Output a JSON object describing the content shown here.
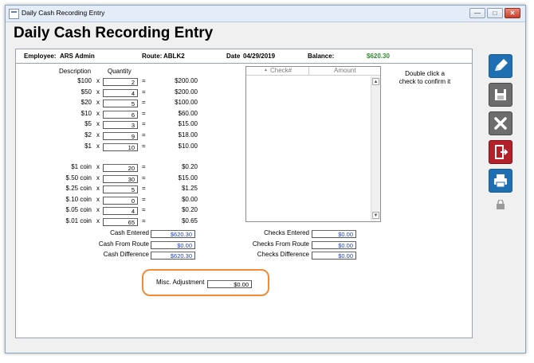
{
  "window": {
    "title": "Daily Cash Recording Entry",
    "minimize": "—",
    "maximize": "□",
    "close": "✕"
  },
  "heading": "Daily Cash Recording Entry",
  "info": {
    "employee_label": "Employee:",
    "employee": "ARS Admin",
    "route_label": "Route:",
    "route": "ABLK2",
    "date_label": "Date",
    "date": "04/29/2019",
    "balance_label": "Balance:",
    "balance": "$620.30"
  },
  "cash": {
    "col_description": "Description",
    "col_quantity": "Quantity",
    "x": "x",
    "eq": "=",
    "bills": [
      {
        "desc": "$100",
        "qty": "2",
        "amount": "$200.00"
      },
      {
        "desc": "$50",
        "qty": "4",
        "amount": "$200.00"
      },
      {
        "desc": "$20",
        "qty": "5",
        "amount": "$100.00"
      },
      {
        "desc": "$10",
        "qty": "6",
        "amount": "$60.00"
      },
      {
        "desc": "$5",
        "qty": "3",
        "amount": "$15.00"
      },
      {
        "desc": "$2",
        "qty": "9",
        "amount": "$18.00"
      },
      {
        "desc": "$1",
        "qty": "10",
        "amount": "$10.00"
      }
    ],
    "coins": [
      {
        "desc": "$1 coin",
        "qty": "20",
        "amount": "$0.20"
      },
      {
        "desc": "$.50 coin",
        "qty": "30",
        "amount": "$15.00"
      },
      {
        "desc": "$.25 coin",
        "qty": "5",
        "amount": "$1.25"
      },
      {
        "desc": "$.10 coin",
        "qty": "0",
        "amount": "$0.00"
      },
      {
        "desc": "$.05 coin",
        "qty": "4",
        "amount": "$0.20"
      },
      {
        "desc": "$.01 coin",
        "qty": "65",
        "amount": "$0.65"
      }
    ],
    "totals": [
      {
        "label": "Cash Entered",
        "value": "$620.30"
      },
      {
        "label": "Cash From Route",
        "value": "$0.00"
      },
      {
        "label": "Cash Difference",
        "value": "$620.30"
      }
    ]
  },
  "checks": {
    "col_check": "Check#",
    "col_amount": "Amount",
    "sort_arrow": "▲",
    "hint": [
      "Double click a",
      "check to confirm it"
    ],
    "totals": [
      {
        "label": "Checks Entered",
        "value": "$0.00"
      },
      {
        "label": "Checks From Route",
        "value": "$0.00"
      },
      {
        "label": "Checks Difference",
        "value": "$0.00"
      }
    ]
  },
  "misc": {
    "label": "Misc. Adjustment",
    "value": "$0.00"
  },
  "colors": {
    "accent_blue": "#1f6fb2",
    "exit_red": "#b3202a",
    "highlight_orange": "#f18b35",
    "balance_green": "#2e8b2e"
  },
  "toolbar": [
    "edit-icon",
    "save-icon",
    "cancel-icon",
    "exit-icon",
    "print-icon",
    "lock-icon"
  ]
}
